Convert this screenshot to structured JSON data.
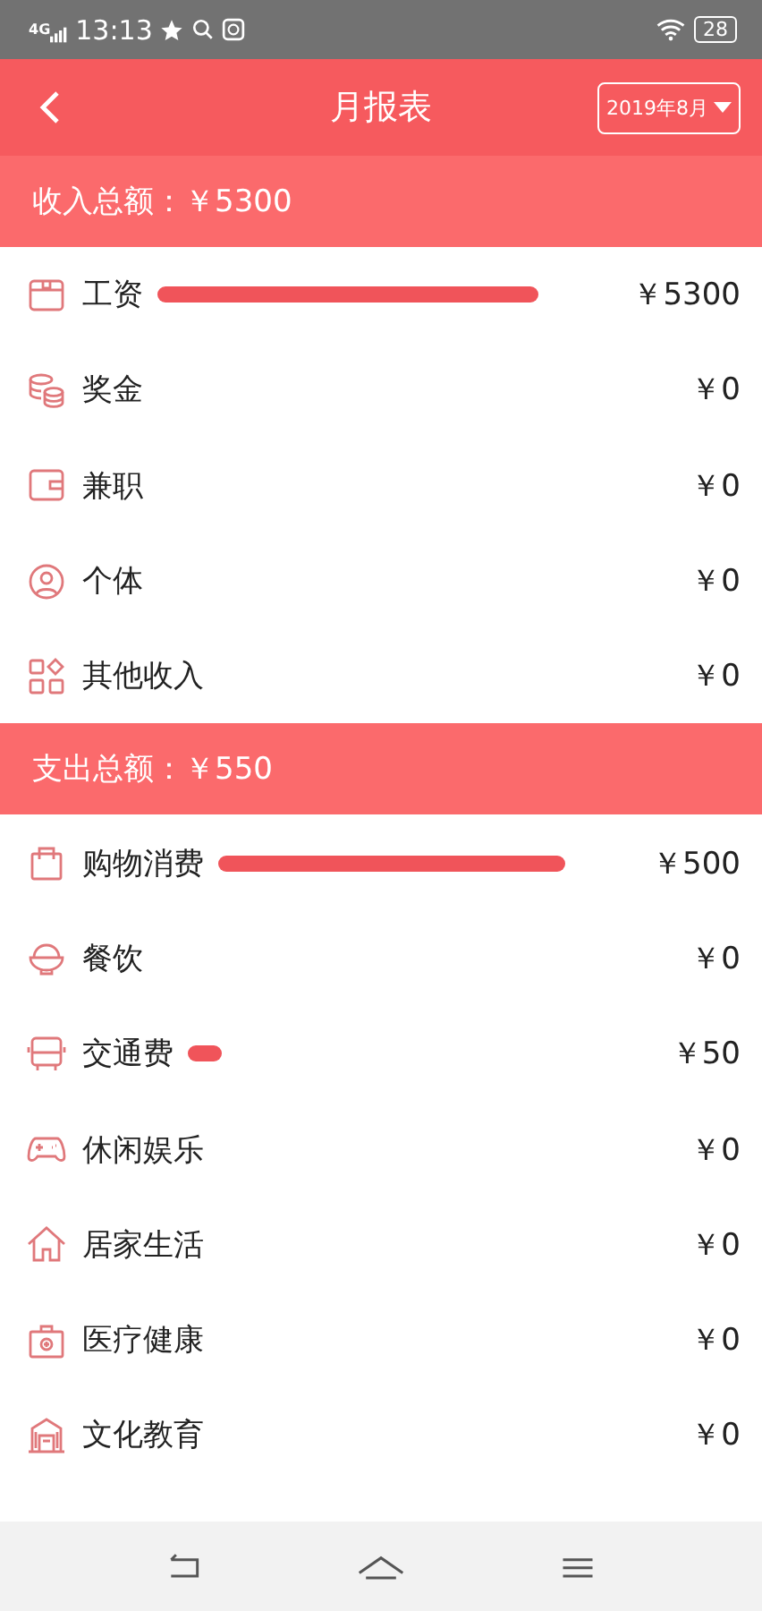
{
  "status_bar": {
    "network": "4G",
    "time": "13:13",
    "battery": "28"
  },
  "header": {
    "title": "月报表",
    "month_picker": "2019年8月"
  },
  "sections": [
    {
      "summary": "收入总额：￥5300",
      "rows": [
        {
          "label": "工资",
          "amount": "￥5300"
        },
        {
          "label": "奖金",
          "amount": "￥0"
        },
        {
          "label": "兼职",
          "amount": "￥0"
        },
        {
          "label": "个体",
          "amount": "￥0"
        },
        {
          "label": "其他收入",
          "amount": "￥0"
        }
      ]
    },
    {
      "summary": "支出总额：￥550",
      "rows": [
        {
          "label": "购物消费",
          "amount": "￥500"
        },
        {
          "label": "餐饮",
          "amount": "￥0"
        },
        {
          "label": "交通费",
          "amount": "￥50"
        },
        {
          "label": "休闲娱乐",
          "amount": "￥0"
        },
        {
          "label": "居家生活",
          "amount": "￥0"
        },
        {
          "label": "医疗健康",
          "amount": "￥0"
        },
        {
          "label": "文化教育",
          "amount": "￥0"
        }
      ]
    }
  ]
}
